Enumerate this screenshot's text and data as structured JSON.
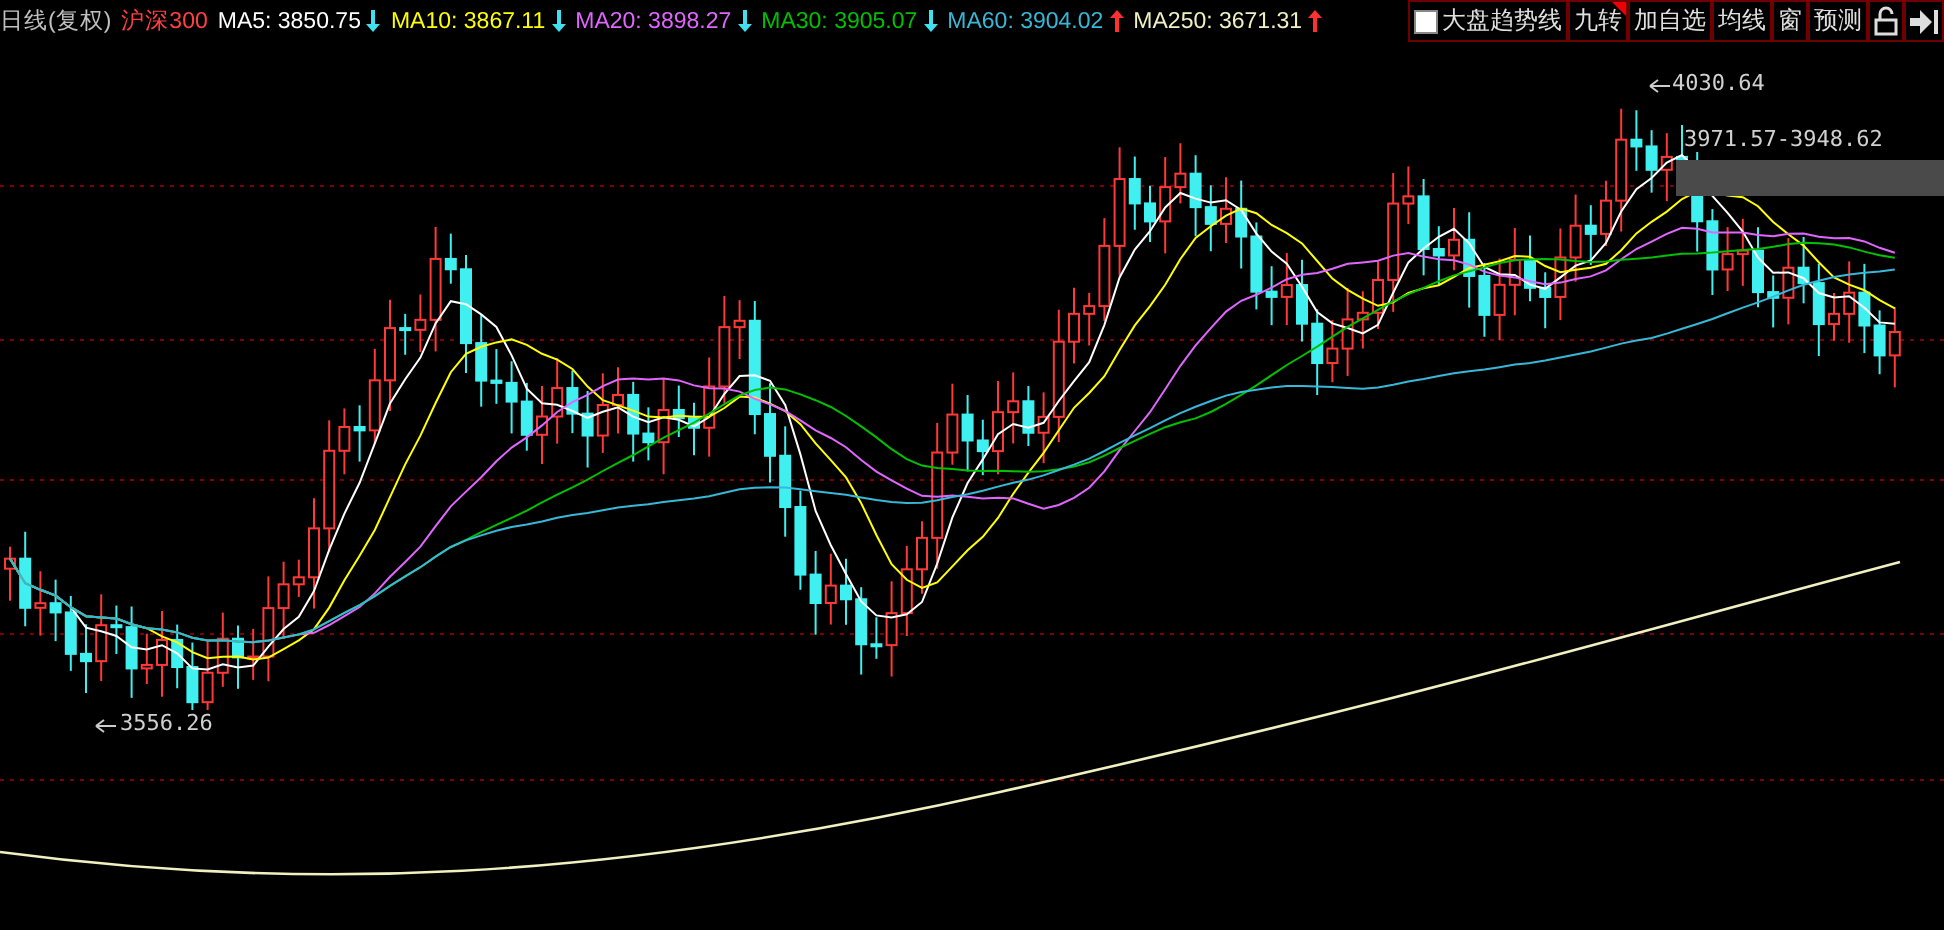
{
  "header": {
    "period": "日线(复权)",
    "index_name": "沪深300",
    "averages": [
      {
        "label": "MA5: 3850.75",
        "color": "#ffffff",
        "rising": false
      },
      {
        "label": "MA10: 3867.11",
        "color": "#ffff00",
        "rising": false
      },
      {
        "label": "MA20: 3898.27",
        "color": "#e066ff",
        "rising": false
      },
      {
        "label": "MA30: 3905.07",
        "color": "#00c000",
        "rising": false
      },
      {
        "label": "MA60: 3904.02",
        "color": "#38b8d8",
        "rising": true
      },
      {
        "label": "MA250: 3671.31",
        "color": "#f0f0c0",
        "rising": true
      }
    ],
    "trend_toggle": {
      "label": "大盘趋势线",
      "checked": false
    },
    "buttons": [
      {
        "label": "九转",
        "flagged": true
      },
      {
        "label": "加自选",
        "flagged": false
      },
      {
        "label": "均线",
        "flagged": false
      },
      {
        "label": "窗",
        "flagged": false
      },
      {
        "label": "预测",
        "flagged": false
      }
    ]
  },
  "chart": {
    "high_label": "4030.64",
    "low_label": "3556.26",
    "range_label": "3971.57-3948.62"
  }
}
